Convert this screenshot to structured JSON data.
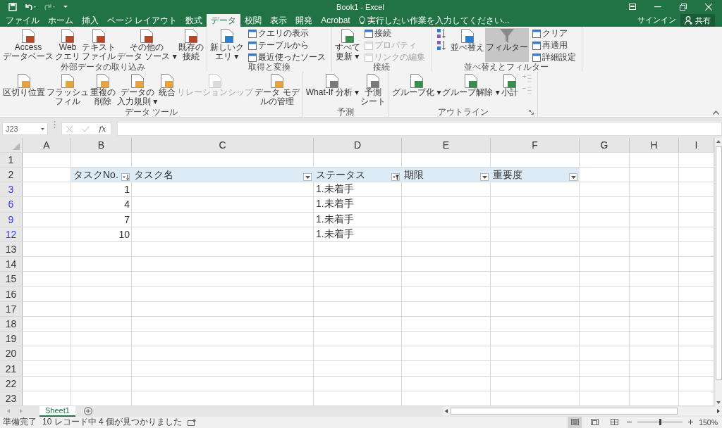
{
  "window": {
    "title": "Book1 - Excel"
  },
  "tabs": [
    {
      "label": "ファイル",
      "selected": false
    },
    {
      "label": "ホーム",
      "selected": false
    },
    {
      "label": "挿入",
      "selected": false
    },
    {
      "label": "ページ レイアウト",
      "selected": false
    },
    {
      "label": "数式",
      "selected": false
    },
    {
      "label": "データ",
      "selected": true
    },
    {
      "label": "校閲",
      "selected": false
    },
    {
      "label": "表示",
      "selected": false
    },
    {
      "label": "開発",
      "selected": false
    },
    {
      "label": "Acrobat",
      "selected": false
    }
  ],
  "tell_me": {
    "placeholder": "実行したい作業を入力してください..."
  },
  "sign_in": "サインイン",
  "share": "共有",
  "ribbon": [
    {
      "label": "外部データの取り込み",
      "items": [
        {
          "kind": "large",
          "lines": [
            "Access",
            "データベース"
          ],
          "disabled": false
        },
        {
          "kind": "large",
          "lines": [
            "Web",
            "クエリ"
          ],
          "disabled": false
        },
        {
          "kind": "large",
          "lines": [
            "テキスト",
            "ファイル"
          ],
          "disabled": false
        },
        {
          "kind": "large",
          "lines": [
            "その他の",
            "データ ソース ▾"
          ],
          "disabled": false
        },
        {
          "kind": "large",
          "lines": [
            "既存の",
            "接続"
          ],
          "disabled": false
        }
      ]
    },
    {
      "label": "取得と変換",
      "items": [
        {
          "kind": "large",
          "lines": [
            "新しいク",
            "エリ ▾"
          ],
          "disabled": false
        },
        {
          "kind": "stack",
          "buttons": [
            {
              "kind": "small",
              "label": "クエリの表示",
              "disabled": false
            },
            {
              "kind": "small",
              "label": "テーブルから",
              "disabled": false
            },
            {
              "kind": "small",
              "label": "最近使ったソース",
              "disabled": false
            }
          ]
        }
      ]
    },
    {
      "label": "接続",
      "items": [
        {
          "kind": "large",
          "lines": [
            "すべて",
            "更新 ▾"
          ],
          "disabled": false
        },
        {
          "kind": "stack",
          "buttons": [
            {
              "kind": "small",
              "label": "接続",
              "disabled": false
            },
            {
              "kind": "small",
              "label": "プロパティ",
              "disabled": true
            },
            {
              "kind": "small",
              "label": "リンクの編集",
              "disabled": true
            }
          ]
        }
      ]
    },
    {
      "label": "並べ替えとフィルター",
      "items": [
        {
          "kind": "stack",
          "buttons": [
            {
              "kind": "sort-asc",
              "disabled": false
            },
            {
              "kind": "sort-desc",
              "disabled": false
            }
          ]
        },
        {
          "kind": "large",
          "lines": [
            "並べ替え"
          ],
          "disabled": false
        },
        {
          "kind": "toggle",
          "lines": [
            "フィルター"
          ],
          "disabled": false,
          "on": true
        },
        {
          "kind": "stack",
          "buttons": [
            {
              "kind": "small",
              "label": "クリア",
              "disabled": false
            },
            {
              "kind": "small",
              "label": "再適用",
              "disabled": false
            },
            {
              "kind": "small",
              "label": "詳細設定",
              "disabled": false
            }
          ]
        }
      ]
    },
    {
      "label": "データ ツール",
      "items": [
        {
          "kind": "large",
          "lines": [
            "区切り位置"
          ],
          "disabled": false
        },
        {
          "kind": "large",
          "lines": [
            "フラッシュ",
            "フィル"
          ],
          "disabled": false
        },
        {
          "kind": "large",
          "lines": [
            "重複の",
            "削除"
          ],
          "disabled": false
        },
        {
          "kind": "large",
          "lines": [
            "データの",
            "入力規則 ▾"
          ],
          "disabled": false
        },
        {
          "kind": "large",
          "lines": [
            "統合"
          ],
          "disabled": false
        },
        {
          "kind": "large",
          "lines": [
            "リレーションシップ"
          ],
          "disabled": true
        },
        {
          "kind": "large",
          "lines": [
            "データ モデ",
            "ルの管理"
          ],
          "disabled": false
        }
      ]
    },
    {
      "label": "予測",
      "items": [
        {
          "kind": "large",
          "lines": [
            "What-If 分析 ▾"
          ],
          "disabled": false
        },
        {
          "kind": "large",
          "lines": [
            "予測",
            "シート"
          ],
          "disabled": false
        }
      ]
    },
    {
      "label": "アウトライン",
      "launcher": true,
      "items": [
        {
          "kind": "large",
          "lines": [
            "グループ化 ▾"
          ],
          "disabled": false
        },
        {
          "kind": "large",
          "lines": [
            "グループ解除 ▾"
          ],
          "disabled": false
        },
        {
          "kind": "large",
          "lines": [
            "小計"
          ],
          "disabled": false
        },
        {
          "kind": "stack",
          "buttons": [
            {
              "kind": "show-detail",
              "disabled": true
            },
            {
              "kind": "hide-detail",
              "disabled": true
            }
          ]
        }
      ]
    }
  ],
  "formula_bar": {
    "name_box": "J23",
    "function_label": "fx"
  },
  "sheet": {
    "columns": [
      "A",
      "B",
      "C",
      "D",
      "E",
      "F",
      "G",
      "H",
      "I"
    ],
    "table_columns": [
      {
        "label": "タスクNo.",
        "sorted": true,
        "filtered": false
      },
      {
        "label": "タスク名",
        "sorted": false,
        "filtered": false
      },
      {
        "label": "ステータス",
        "sorted": false,
        "filtered": true
      },
      {
        "label": "期限",
        "sorted": false,
        "filtered": false
      },
      {
        "label": "重要度",
        "sorted": false,
        "filtered": false
      }
    ],
    "rows": [
      {
        "number": "1",
        "kind": "empty",
        "filtered": false
      },
      {
        "number": "2",
        "kind": "header",
        "filtered": false
      },
      {
        "number": "3",
        "kind": "data",
        "filtered": true,
        "task_no": "1",
        "status": "1.未着手"
      },
      {
        "number": "6",
        "kind": "data",
        "filtered": true,
        "task_no": "4",
        "status": "1.未着手"
      },
      {
        "number": "9",
        "kind": "data",
        "filtered": true,
        "task_no": "7",
        "status": "1.未着手"
      },
      {
        "number": "12",
        "kind": "data",
        "filtered": true,
        "task_no": "10",
        "status": "1.未着手"
      },
      {
        "number": "13",
        "kind": "empty",
        "filtered": false
      },
      {
        "number": "14",
        "kind": "empty",
        "filtered": false
      },
      {
        "number": "15",
        "kind": "empty",
        "filtered": false
      },
      {
        "number": "16",
        "kind": "empty",
        "filtered": false
      },
      {
        "number": "17",
        "kind": "empty",
        "filtered": false
      },
      {
        "number": "18",
        "kind": "empty",
        "filtered": false
      },
      {
        "number": "19",
        "kind": "empty",
        "filtered": false
      },
      {
        "number": "20",
        "kind": "empty",
        "filtered": false
      },
      {
        "number": "21",
        "kind": "empty",
        "filtered": false
      },
      {
        "number": "22",
        "kind": "empty",
        "filtered": false
      },
      {
        "number": "23",
        "kind": "empty",
        "filtered": false
      }
    ]
  },
  "sheet_tabs": [
    {
      "label": "Sheet1",
      "selected": true
    }
  ],
  "status_bar": {
    "ready": "準備完了",
    "message": "10 レコード中 4 個が見つかりました",
    "views": [
      {
        "kind": "normal",
        "selected": true
      },
      {
        "kind": "page-layout",
        "selected": false
      },
      {
        "kind": "page-break",
        "selected": false
      }
    ],
    "zoom": {
      "level": 0.5,
      "label": "150%"
    }
  }
}
